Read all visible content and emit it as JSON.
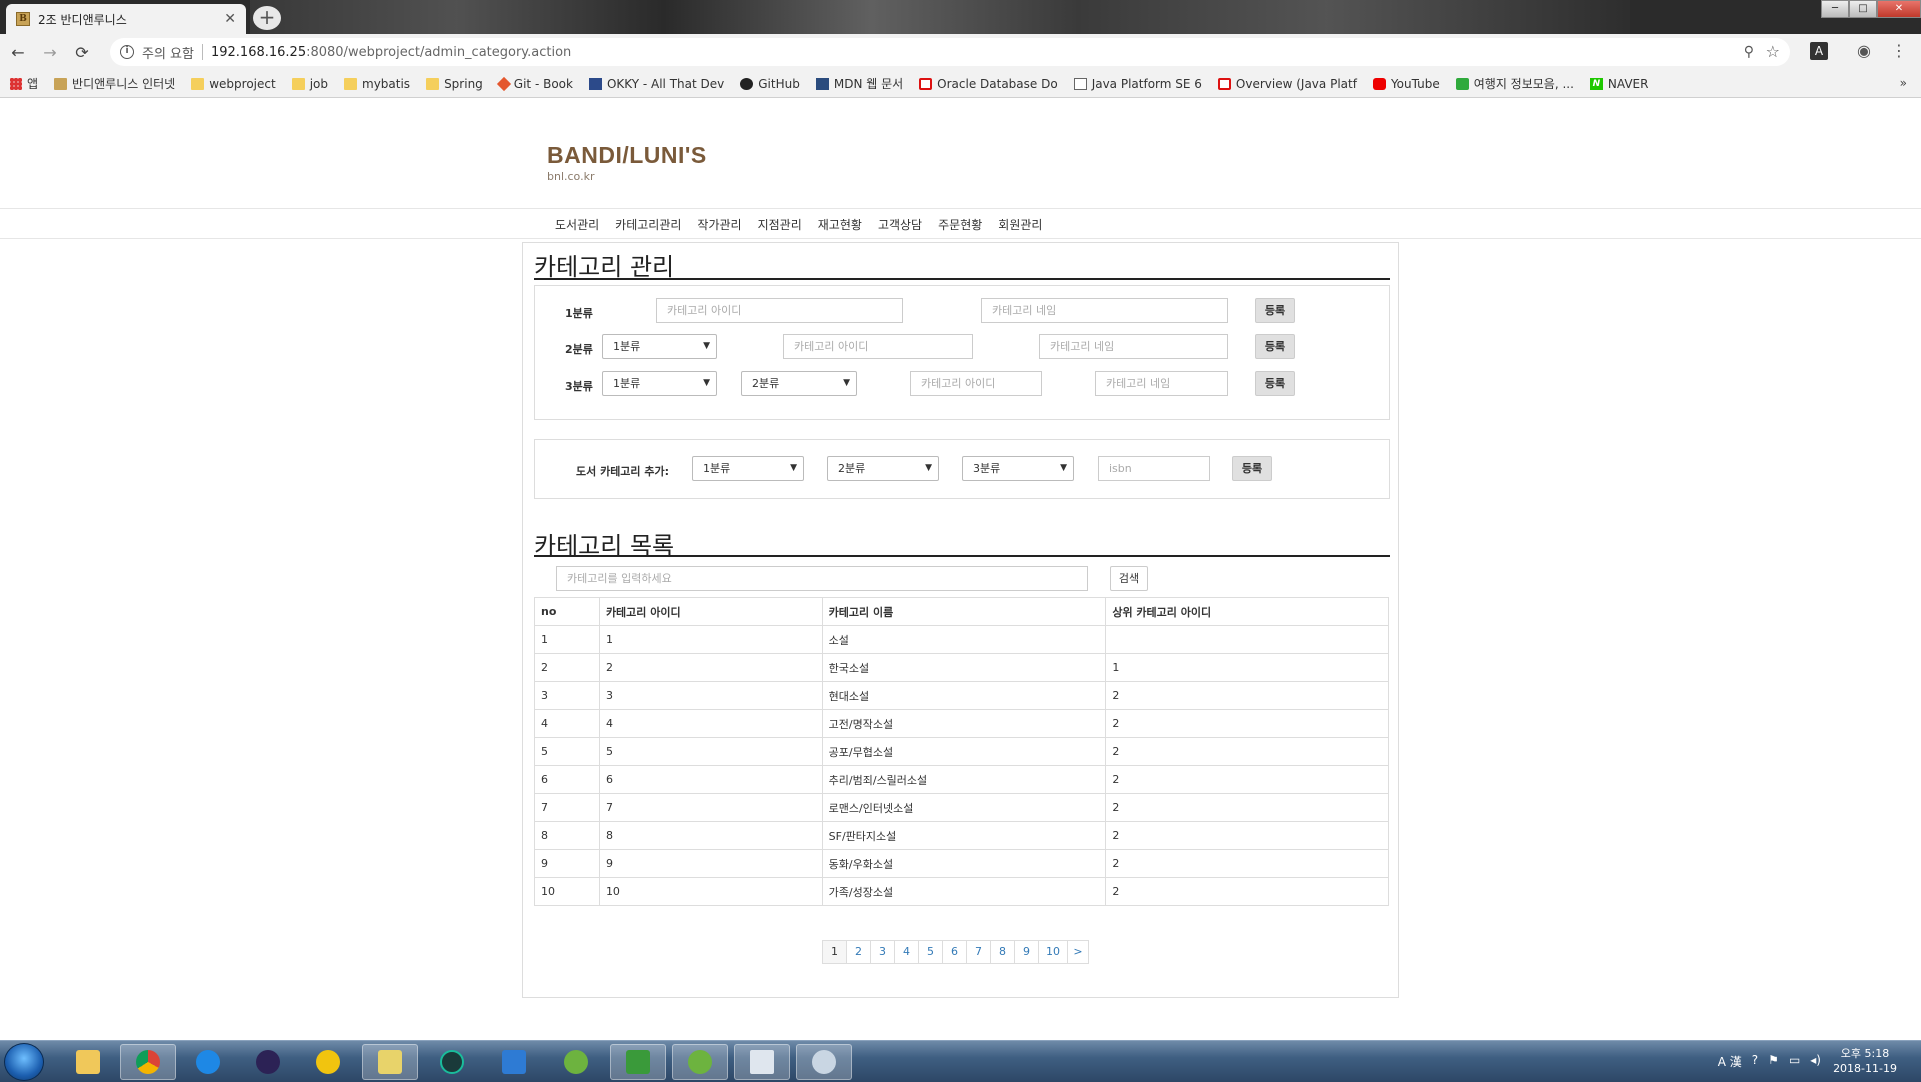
{
  "browser": {
    "tab_title": "2조 반디앤루니스",
    "tab_favicon_text": "B",
    "tab_close": "✕",
    "new_tab": "+",
    "security_label": "주의 요함",
    "url_host": "192.168.16.25",
    "url_path": ":8080/webproject/admin_category.action",
    "back": "←",
    "forward": "→",
    "reload": "⟳",
    "zoom_icon": "⚲",
    "star_icon": "☆",
    "ext_icon": "A",
    "profile_icon": "◉",
    "menu_icon": "⋮",
    "win_min": "─",
    "win_max": "□",
    "win_close": "✕"
  },
  "bookmarks": [
    {
      "label": "앱",
      "icon": "apps-icon"
    },
    {
      "label": "반디앤루니스 인터넷",
      "icon": "favicon-b"
    },
    {
      "label": "webproject",
      "icon": "folder-icon"
    },
    {
      "label": "job",
      "icon": "folder-icon"
    },
    {
      "label": "mybatis",
      "icon": "folder-icon"
    },
    {
      "label": "Spring",
      "icon": "folder-icon"
    },
    {
      "label": "Git - Book",
      "icon": "git-icon"
    },
    {
      "label": "OKKY - All That Dev",
      "icon": "okky-icon"
    },
    {
      "label": "GitHub",
      "icon": "github-icon"
    },
    {
      "label": "MDN 웹 문서",
      "icon": "mdn-icon"
    },
    {
      "label": "Oracle Database Do",
      "icon": "oracle-icon"
    },
    {
      "label": "Java Platform SE 6",
      "icon": "doc-icon"
    },
    {
      "label": "Overview (Java Platf",
      "icon": "oracle-icon"
    },
    {
      "label": "YouTube",
      "icon": "youtube-icon"
    },
    {
      "label": "여행지 정보모음, ...",
      "icon": "tour-icon"
    },
    {
      "label": "NAVER",
      "icon": "naver-icon"
    }
  ],
  "bookmarks_more": "»",
  "site": {
    "brand": "BANDI/LUNI'S",
    "domain": "bnl.co.kr",
    "nav": [
      "도서관리",
      "카테고리관리",
      "작가관리",
      "지점관리",
      "재고현황",
      "고객상담",
      "주문현황",
      "회원관리"
    ]
  },
  "category_mgmt": {
    "title": "카테고리 관리",
    "row1": {
      "label": "1분류",
      "id_placeholder": "카테고리 아이디",
      "name_placeholder": "카테고리 네임",
      "button": "등록"
    },
    "row2": {
      "label": "2분류",
      "select1": "1분류",
      "id_placeholder": "카테고리 아이디",
      "name_placeholder": "카테고리 네임",
      "button": "등록"
    },
    "row3": {
      "label": "3분류",
      "select1": "1분류",
      "select2": "2분류",
      "id_placeholder": "카테고리 아이디",
      "name_placeholder": "카테고리 네임",
      "button": "등록"
    }
  },
  "book_category": {
    "label": "도서 카테고리 추가:",
    "select1": "1분류",
    "select2": "2분류",
    "select3": "3분류",
    "isbn_placeholder": "isbn",
    "button": "등록"
  },
  "category_list": {
    "title": "카테고리 목록",
    "search_placeholder": "카테고리를 입력하세요",
    "search_button": "검색",
    "columns": [
      "no",
      "카테고리 아이디",
      "카테고리 이름",
      "상위 카테고리 아이디"
    ],
    "rows": [
      [
        "1",
        "1",
        "소설",
        ""
      ],
      [
        "2",
        "2",
        "한국소설",
        "1"
      ],
      [
        "3",
        "3",
        "현대소설",
        "2"
      ],
      [
        "4",
        "4",
        "고전/명작소설",
        "2"
      ],
      [
        "5",
        "5",
        "공포/무협소설",
        "2"
      ],
      [
        "6",
        "6",
        "추리/범죄/스릴러소설",
        "2"
      ],
      [
        "7",
        "7",
        "로맨스/인터넷소설",
        "2"
      ],
      [
        "8",
        "8",
        "SF/판타지소설",
        "2"
      ],
      [
        "9",
        "9",
        "동화/우화소설",
        "2"
      ],
      [
        "10",
        "10",
        "가족/성장소설",
        "2"
      ]
    ],
    "pages": [
      "1",
      "2",
      "3",
      "4",
      "5",
      "6",
      "7",
      "8",
      "9",
      "10"
    ],
    "next": ">"
  },
  "taskbar": {
    "tray_ime": "A 漢",
    "tray_help": "?",
    "clock_time": "오후 5:18",
    "clock_date": "2018-11-19"
  },
  "select_arrow": "▼"
}
